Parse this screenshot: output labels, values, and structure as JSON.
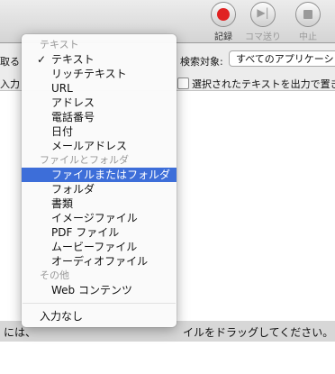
{
  "toolbar": {
    "record_label": "記録",
    "step_label": "コマ送り",
    "stop_label": "中止"
  },
  "action": {
    "row1_left": "取る",
    "search_label": "検索対象:",
    "search_value": "すべてのアプリケーシ",
    "row2_left": "入力",
    "output_label": "選択されたテキストを出力で置き"
  },
  "workflow": {
    "hint_left": "には、",
    "hint_right": "イルをドラッグしてください。"
  },
  "menu": {
    "items": [
      {
        "type": "header",
        "label": "テキスト"
      },
      {
        "type": "item",
        "label": "テキスト",
        "checked": true
      },
      {
        "type": "item",
        "label": "リッチテキスト"
      },
      {
        "type": "item",
        "label": "URL"
      },
      {
        "type": "item",
        "label": "アドレス"
      },
      {
        "type": "item",
        "label": "電話番号"
      },
      {
        "type": "item",
        "label": "日付"
      },
      {
        "type": "item",
        "label": "メールアドレス"
      },
      {
        "type": "header",
        "label": "ファイルとフォルダ"
      },
      {
        "type": "item",
        "label": "ファイルまたはフォルダ",
        "selected": true
      },
      {
        "type": "item",
        "label": "フォルダ"
      },
      {
        "type": "item",
        "label": "書類"
      },
      {
        "type": "item",
        "label": "イメージファイル"
      },
      {
        "type": "item",
        "label": "PDF ファイル"
      },
      {
        "type": "item",
        "label": "ムービーファイル"
      },
      {
        "type": "item",
        "label": "オーディオファイル"
      },
      {
        "type": "header",
        "label": "その他"
      },
      {
        "type": "item",
        "label": "Web コンテンツ"
      },
      {
        "type": "item",
        "label": "入力なし"
      }
    ]
  },
  "check_glyph": "✓",
  "colors": {
    "selection": "#3d6ed9",
    "record_red": "#e02222"
  },
  "icons": [
    "record-icon",
    "step-icon",
    "stop-icon",
    "checkmark-icon"
  ]
}
